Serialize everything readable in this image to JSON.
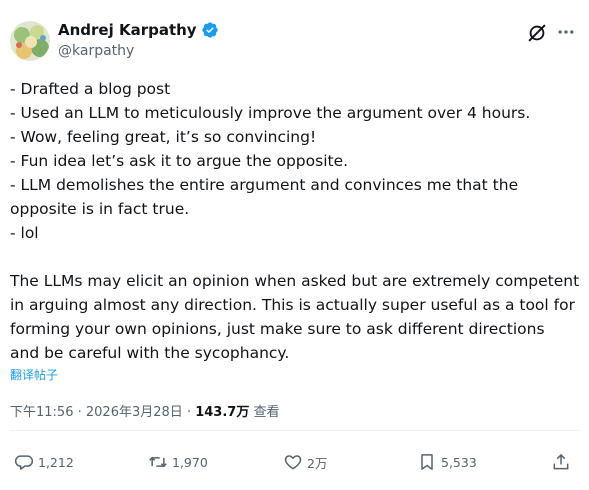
{
  "author": {
    "name": "Andrej Karpathy",
    "handle": "@karpathy",
    "verified": true
  },
  "header_icons": [
    "grok-icon",
    "more-icon"
  ],
  "body_lines": [
    "- Drafted a blog post",
    "- Used an LLM to meticulously improve the argument over 4 hours.",
    "- Wow, feeling great, it’s so convincing!",
    "- Fun idea let’s ask it to argue the opposite.",
    "- LLM demolishes the entire argument and convinces me that the",
    "opposite is in fact true.",
    "- lol",
    "",
    "The LLMs may elicit an opinion when asked but are extremely competent",
    "in arguing almost any direction. This is actually super useful as a tool for",
    "forming your own opinions, just make sure to ask different directions",
    "and be careful with the sycophancy."
  ],
  "translate_label": "翻译帖子",
  "meta": {
    "time": "下午11:56",
    "separator": "·",
    "date": "2026年3月28日",
    "views": "143.7万",
    "views_label": "查看"
  },
  "actions": {
    "reply": {
      "icon": "reply-icon",
      "count": "1,212"
    },
    "repost": {
      "icon": "repost-icon",
      "count": "1,970"
    },
    "like": {
      "icon": "heart-icon",
      "count": "2万"
    },
    "bookmark": {
      "icon": "bookmark-icon",
      "count": "5,533"
    },
    "share": {
      "icon": "share-icon"
    }
  },
  "colors": {
    "text": "#0f1419",
    "secondary": "#536471",
    "link": "#1d9bf0",
    "verified": "#1d9bf0",
    "divider": "#eff3f4"
  }
}
